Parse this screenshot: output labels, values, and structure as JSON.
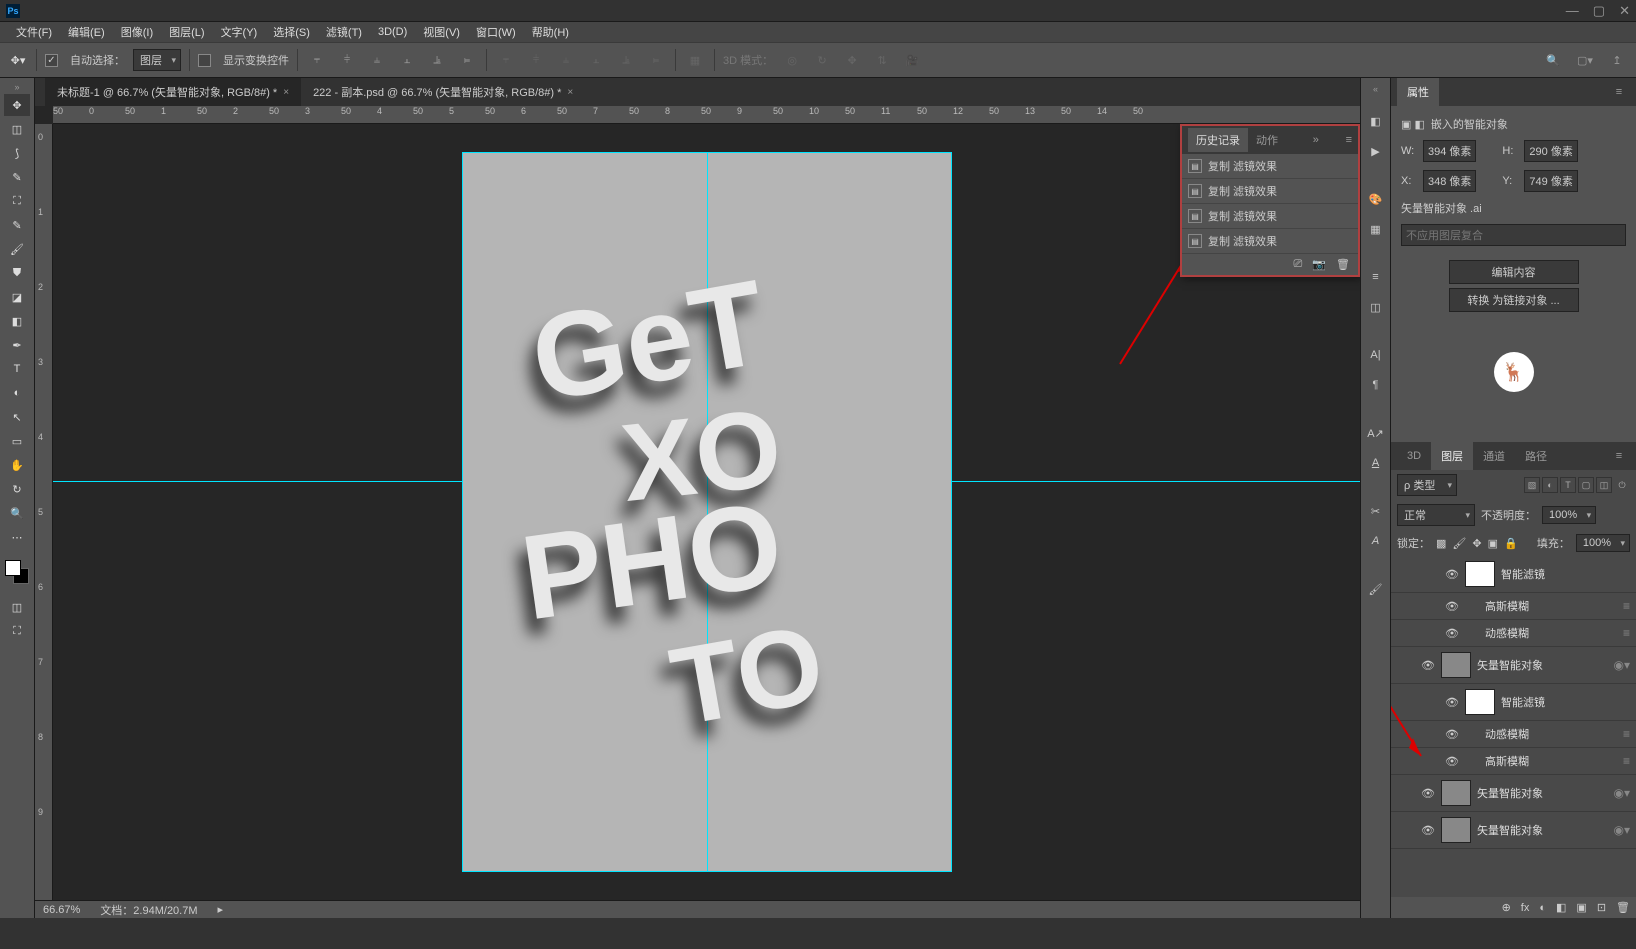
{
  "menubar": [
    "文件(F)",
    "编辑(E)",
    "图像(I)",
    "图层(L)",
    "文字(Y)",
    "选择(S)",
    "滤镜(T)",
    "3D(D)",
    "视图(V)",
    "窗口(W)",
    "帮助(H)"
  ],
  "options": {
    "auto_select": "自动选择：",
    "target": "图层",
    "show_controls": "显示变换控件",
    "mode3d_label": "3D 模式："
  },
  "doc_tabs": [
    {
      "label": "未标题-1 @ 66.7% (矢量智能对象, RGB/8#) *",
      "active": true
    },
    {
      "label": "222 - 副本.psd @ 66.7% (矢量智能对象, RGB/8#) *",
      "active": false
    }
  ],
  "ruler_h": [
    "50",
    "0",
    "50",
    "1",
    "50",
    "2",
    "50",
    "3",
    "50",
    "4",
    "50",
    "5",
    "50",
    "6",
    "50",
    "7",
    "50",
    "8",
    "50",
    "9",
    "50",
    "10",
    "50",
    "11",
    "50",
    "12",
    "50",
    "13",
    "50",
    "14",
    "50"
  ],
  "ruler_v": [
    "0",
    "1",
    "2",
    "3",
    "4",
    "5",
    "6",
    "7",
    "8",
    "9"
  ],
  "status": {
    "zoom": "66.67%",
    "doc": "文档：2.94M/20.7M"
  },
  "history": {
    "tab1": "历史记录",
    "tab2": "动作",
    "items": [
      "复制 滤镜效果",
      "复制 滤镜效果",
      "复制 滤镜效果",
      "复制 滤镜效果"
    ]
  },
  "props": {
    "panel_tab": "属性",
    "title": "嵌入的智能对象",
    "w_label": "W:",
    "w_val": "394 像素",
    "h_label": "H:",
    "h_val": "290 像素",
    "x_label": "X:",
    "x_val": "348 像素",
    "y_label": "Y:",
    "y_val": "749 像素",
    "file": "矢量智能对象 .ai",
    "comp": "不应用图层复合",
    "btn_edit": "编辑内容",
    "btn_link": "转换 为链接对象 ..."
  },
  "layers": {
    "tabs": [
      "3D",
      "图层",
      "通道",
      "路径"
    ],
    "kind": "ρ 类型",
    "blend": "正常",
    "opacity_label": "不透明度：",
    "opacity": "100%",
    "lock_label": "锁定：",
    "fill_label": "填充：",
    "fill": "100%",
    "items": [
      {
        "indent": 2,
        "name": "智能滤镜",
        "thumb": "white",
        "eye": true
      },
      {
        "indent": 2,
        "name": "高斯模糊",
        "sub": true,
        "eye": true,
        "badge": "≡"
      },
      {
        "indent": 2,
        "name": "动感模糊",
        "sub": true,
        "eye": true,
        "badge": "≡"
      },
      {
        "indent": 1,
        "name": "矢量智能对象",
        "thumb": "grey",
        "eye": true,
        "badge": "◉▾"
      },
      {
        "indent": 2,
        "name": "智能滤镜",
        "thumb": "white",
        "eye": true
      },
      {
        "indent": 2,
        "name": "动感模糊",
        "sub": true,
        "eye": true,
        "badge": "≡"
      },
      {
        "indent": 2,
        "name": "高斯模糊",
        "sub": true,
        "eye": true,
        "badge": "≡"
      },
      {
        "indent": 1,
        "name": "矢量智能对象",
        "thumb": "grey",
        "eye": true,
        "badge": "◉▾"
      },
      {
        "indent": 1,
        "name": "矢量智能对象",
        "thumb": "grey",
        "eye": true,
        "badge": "◉▾"
      }
    ],
    "footer_icons": [
      "⊕",
      "fx",
      "◐",
      "◧",
      "▣",
      "⊡",
      "🗑"
    ]
  }
}
